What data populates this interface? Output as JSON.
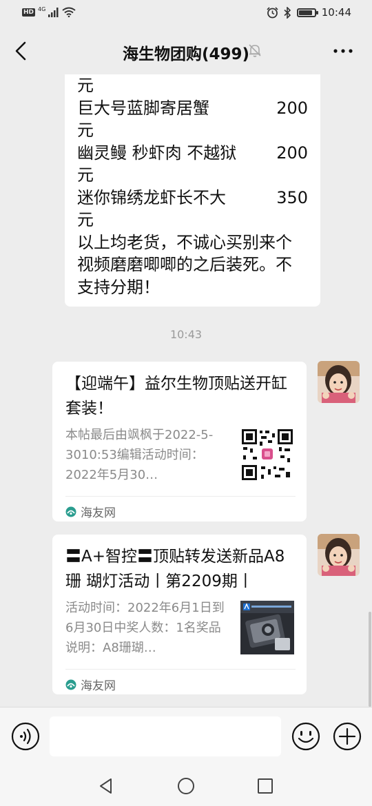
{
  "status_bar": {
    "hd": "HD",
    "network": "4G",
    "time": "10:44"
  },
  "nav": {
    "title": "海生物团购(499)",
    "back_icon": "chevron-left-icon",
    "mute_icon": "bell-off-icon",
    "more_icon": "more-dots-icon"
  },
  "message_text": {
    "lines": [
      {
        "name": "",
        "price": "元"
      },
      {
        "name": "巨大号蓝脚寄居蟹",
        "price": "200"
      },
      {
        "name": "",
        "price": "元"
      },
      {
        "name": "幽灵鳗 秒虾肉  不越狱",
        "price": "200"
      },
      {
        "name": "",
        "price": "元"
      },
      {
        "name": "迷你锦绣龙虾长不大",
        "price": "350"
      },
      {
        "name": "",
        "price": "元"
      }
    ],
    "footer": "以上均老货，不诚心买别来个视频磨磨唧唧的之后装死。不支持分期！"
  },
  "timestamp": "10:43",
  "cards": [
    {
      "title": "【迎端午】益尔生物顶贴送开缸套装！",
      "desc": "本帖最后由飒枫于2022-5-3010:53编辑活动时间：2022年5月30…",
      "source": "海友网",
      "thumb": "qr-code-image"
    },
    {
      "title": "〓A+智控〓顶贴转发送新品A8珊 瑚灯活动丨第2209期丨",
      "desc": "活动时间：2022年6月1日到6月30日中奖人数：1名奖品说明：A8珊瑚…",
      "source": "海友网",
      "thumb": "coral-light-product-image"
    }
  ],
  "input_bar": {
    "voice_icon": "voice-icon",
    "placeholder": "",
    "emoji_icon": "emoji-icon",
    "plus_icon": "plus-icon"
  },
  "system_nav": {
    "back": "triangle-back-icon",
    "home": "circle-home-icon",
    "recent": "square-recent-icon"
  },
  "colors": {
    "background": "#ededed",
    "bubble": "#ffffff",
    "muted_text": "#8a8a8a",
    "source_icon": "#2a9d8f"
  }
}
